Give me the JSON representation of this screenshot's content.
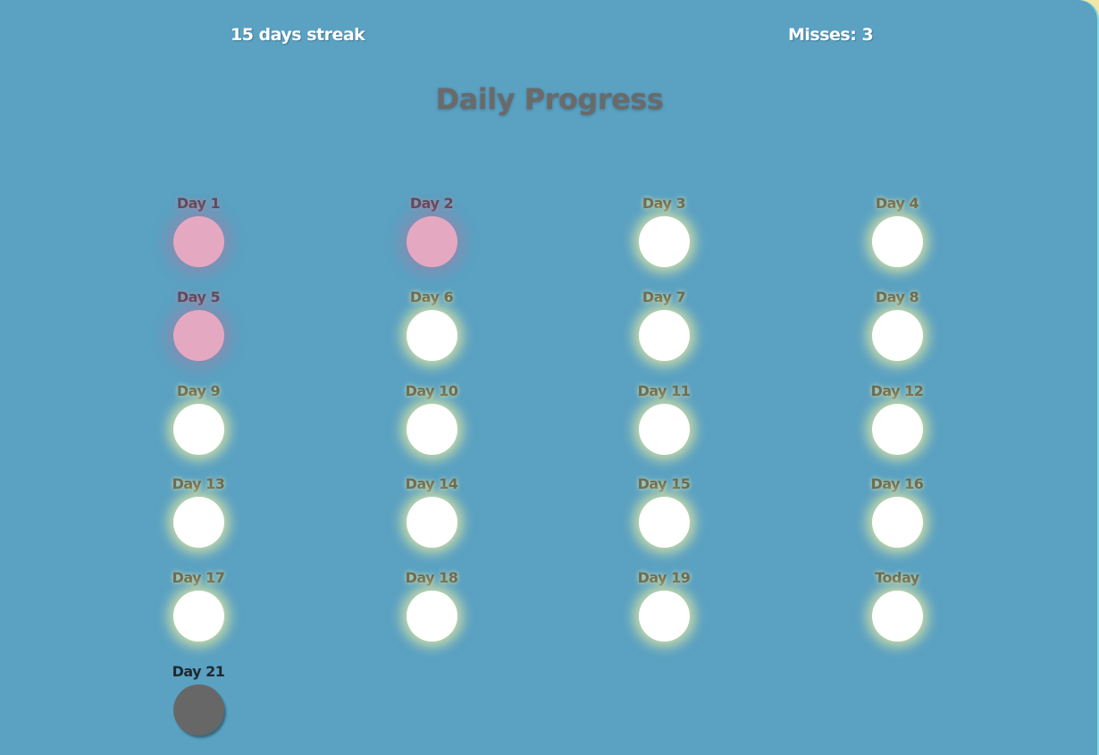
{
  "header": {
    "streak_text": "15 days streak",
    "misses_text": "Misses: 3"
  },
  "title": "Daily Progress",
  "colors": {
    "background": "#5aa1c2",
    "completed": "#ffffff",
    "missed": "#e5a8c1",
    "pending": "#676767",
    "glow": "#eeeea0"
  },
  "days": [
    {
      "label": "Day 1",
      "status": "missed"
    },
    {
      "label": "Day 2",
      "status": "missed"
    },
    {
      "label": "Day 3",
      "status": "completed"
    },
    {
      "label": "Day 4",
      "status": "completed"
    },
    {
      "label": "Day 5",
      "status": "missed"
    },
    {
      "label": "Day 6",
      "status": "completed"
    },
    {
      "label": "Day 7",
      "status": "completed"
    },
    {
      "label": "Day 8",
      "status": "completed"
    },
    {
      "label": "Day 9",
      "status": "completed"
    },
    {
      "label": "Day 10",
      "status": "completed"
    },
    {
      "label": "Day 11",
      "status": "completed"
    },
    {
      "label": "Day 12",
      "status": "completed"
    },
    {
      "label": "Day 13",
      "status": "completed"
    },
    {
      "label": "Day 14",
      "status": "completed"
    },
    {
      "label": "Day 15",
      "status": "completed"
    },
    {
      "label": "Day 16",
      "status": "completed"
    },
    {
      "label": "Day 17",
      "status": "completed"
    },
    {
      "label": "Day 18",
      "status": "completed"
    },
    {
      "label": "Day 19",
      "status": "completed"
    },
    {
      "label": "Today",
      "status": "completed"
    },
    {
      "label": "Day 21",
      "status": "pending"
    }
  ]
}
